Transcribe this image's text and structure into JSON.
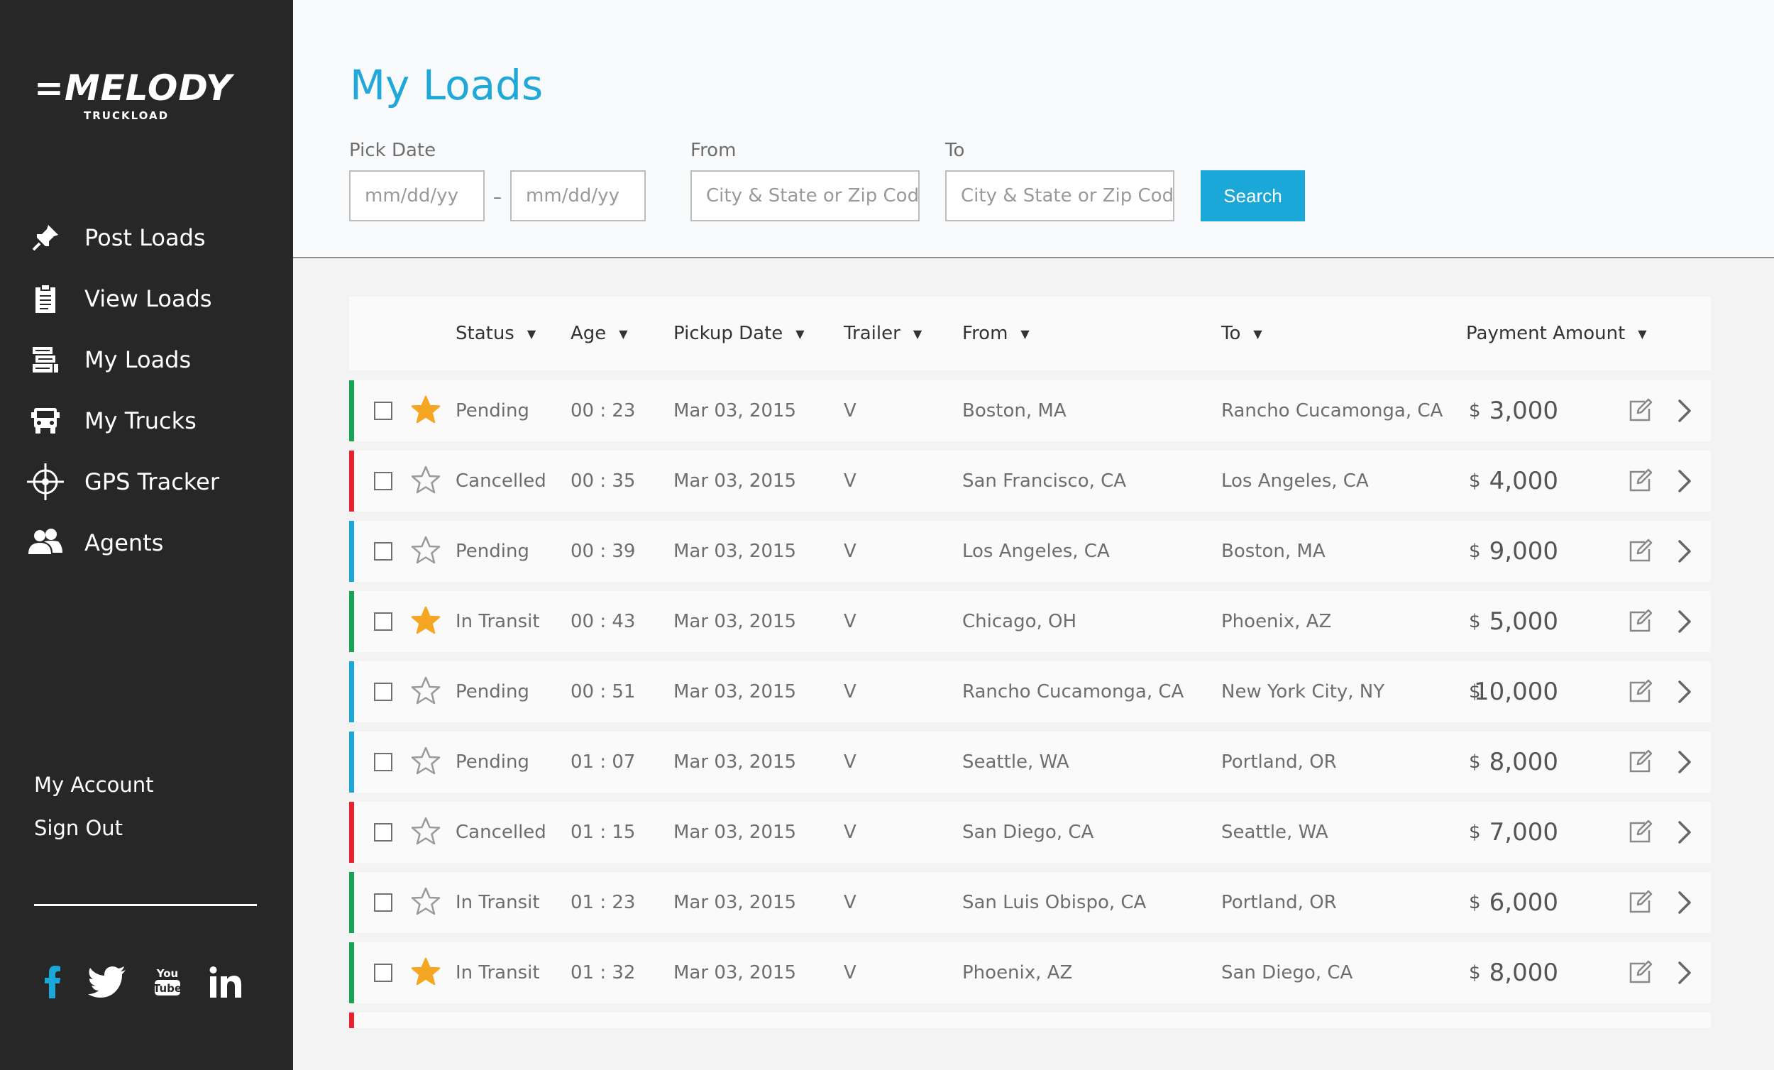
{
  "brand": {
    "name": "=MELODY",
    "sub": "TRUCKLOAD"
  },
  "sidebar": {
    "items": [
      {
        "label": "Post Loads",
        "icon": "pushpin-icon"
      },
      {
        "label": "View Loads",
        "icon": "clipboard-icon"
      },
      {
        "label": "My Loads",
        "icon": "stacked-boxes-icon"
      },
      {
        "label": "My Trucks",
        "icon": "truck-icon"
      },
      {
        "label": "GPS Tracker",
        "icon": "crosshair-icon"
      },
      {
        "label": "Agents",
        "icon": "users-icon"
      }
    ],
    "account": {
      "my_account": "My Account",
      "sign_out": "Sign Out"
    },
    "social": [
      "facebook-icon",
      "twitter-icon",
      "youtube-icon",
      "linkedin-icon"
    ]
  },
  "header": {
    "title": "My Loads",
    "pick_date_label": "Pick Date",
    "pick_from_placeholder": "mm/dd/yy",
    "pick_to_placeholder": "mm/dd/yy",
    "dash": "–",
    "from_label": "From",
    "from_placeholder": "City & State or Zip Code",
    "to_label": "To",
    "to_placeholder": "City & State or Zip Code",
    "search_label": "Search"
  },
  "table": {
    "columns": {
      "status": "Status",
      "age": "Age",
      "pickup": "Pickup Date",
      "trailer": "Trailer",
      "from": "From",
      "to": "To",
      "payment": "Payment Amount"
    },
    "currency": "$",
    "rows": [
      {
        "status": "Pending",
        "age": "00 : 23",
        "pickup": "Mar 03, 2015",
        "trailer": "V",
        "from": "Boston, MA",
        "to": "Rancho Cucamonga, CA",
        "amount": "3,000",
        "starred": true,
        "bar": "#17a455"
      },
      {
        "status": "Cancelled",
        "age": "00 : 35",
        "pickup": "Mar 03, 2015",
        "trailer": "V",
        "from": "San Francisco, CA",
        "to": "Los Angeles, CA",
        "amount": "4,000",
        "starred": false,
        "bar": "#e8232f"
      },
      {
        "status": "Pending",
        "age": "00 : 39",
        "pickup": "Mar 03, 2015",
        "trailer": "V",
        "from": "Los Angeles, CA",
        "to": "Boston, MA",
        "amount": "9,000",
        "starred": false,
        "bar": "#1ba8d8"
      },
      {
        "status": "In Transit",
        "age": "00 : 43",
        "pickup": "Mar 03, 2015",
        "trailer": "V",
        "from": "Chicago, OH",
        "to": "Phoenix, AZ",
        "amount": "5,000",
        "starred": true,
        "bar": "#17a455"
      },
      {
        "status": "Pending",
        "age": "00 : 51",
        "pickup": "Mar 03, 2015",
        "trailer": "V",
        "from": "Rancho Cucamonga, CA",
        "to": "New York City, NY",
        "amount": "10,000",
        "starred": false,
        "bar": "#1ba8d8"
      },
      {
        "status": "Pending",
        "age": "01 : 07",
        "pickup": "Mar 03, 2015",
        "trailer": "V",
        "from": "Seattle, WA",
        "to": "Portland, OR",
        "amount": "8,000",
        "starred": false,
        "bar": "#1ba8d8"
      },
      {
        "status": "Cancelled",
        "age": "01 : 15",
        "pickup": "Mar 03, 2015",
        "trailer": "V",
        "from": "San Diego, CA",
        "to": "Seattle, WA",
        "amount": "7,000",
        "starred": false,
        "bar": "#e8232f"
      },
      {
        "status": "In Transit",
        "age": "01 : 23",
        "pickup": "Mar 03, 2015",
        "trailer": "V",
        "from": "San Luis Obispo, CA",
        "to": "Portland, OR",
        "amount": "6,000",
        "starred": false,
        "bar": "#17a455"
      },
      {
        "status": "In Transit",
        "age": "01 : 32",
        "pickup": "Mar 03, 2015",
        "trailer": "V",
        "from": "Phoenix, AZ",
        "to": "San Diego, CA",
        "amount": "8,000",
        "starred": true,
        "bar": "#17a455"
      }
    ]
  },
  "colors": {
    "accent": "#1ba8d8",
    "star": "#f5a623",
    "green": "#17a455",
    "red": "#e8232f",
    "sidebar": "#272727"
  }
}
